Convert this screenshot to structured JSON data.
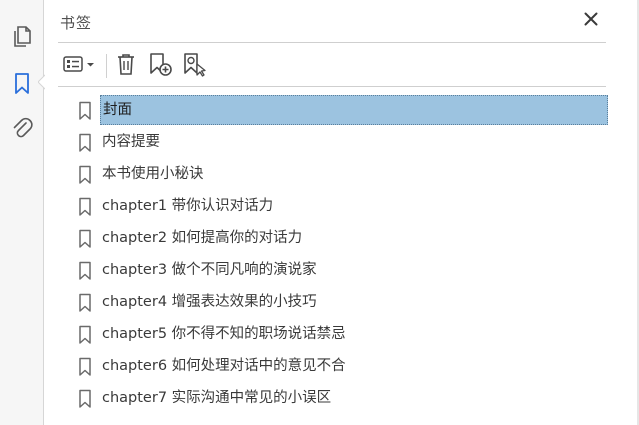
{
  "rail": {
    "buttons": [
      {
        "name": "pages-icon"
      },
      {
        "name": "bookmark-icon"
      },
      {
        "name": "attachment-icon"
      }
    ],
    "active_color": "#2a6fdb"
  },
  "panel": {
    "title": "书签"
  },
  "toolbar": {
    "options_icon": "list-options-icon",
    "delete_icon": "trash-icon",
    "new_bookmark_icon": "new-bookmark-icon",
    "find_bookmark_icon": "find-bookmark-icon"
  },
  "bookmarks": [
    {
      "label": "封面",
      "selected": true
    },
    {
      "label": "内容提要",
      "selected": false
    },
    {
      "label": "本书使用小秘诀",
      "selected": false
    },
    {
      "label": "chapter1 带你认识对话力",
      "selected": false
    },
    {
      "label": "chapter2 如何提高你的对话力",
      "selected": false
    },
    {
      "label": "chapter3 做个不同凡响的演说家",
      "selected": false
    },
    {
      "label": "chapter4 增强表达效果的小技巧",
      "selected": false
    },
    {
      "label": "chapter5 你不得不知的职场说话禁忌",
      "selected": false
    },
    {
      "label": "chapter6 如何处理对话中的意见不合",
      "selected": false
    },
    {
      "label": "chapter7 实际沟通中常见的小误区",
      "selected": false
    }
  ],
  "colors": {
    "selection_bg": "#9cc3e0",
    "accent": "#2a6fdb"
  }
}
